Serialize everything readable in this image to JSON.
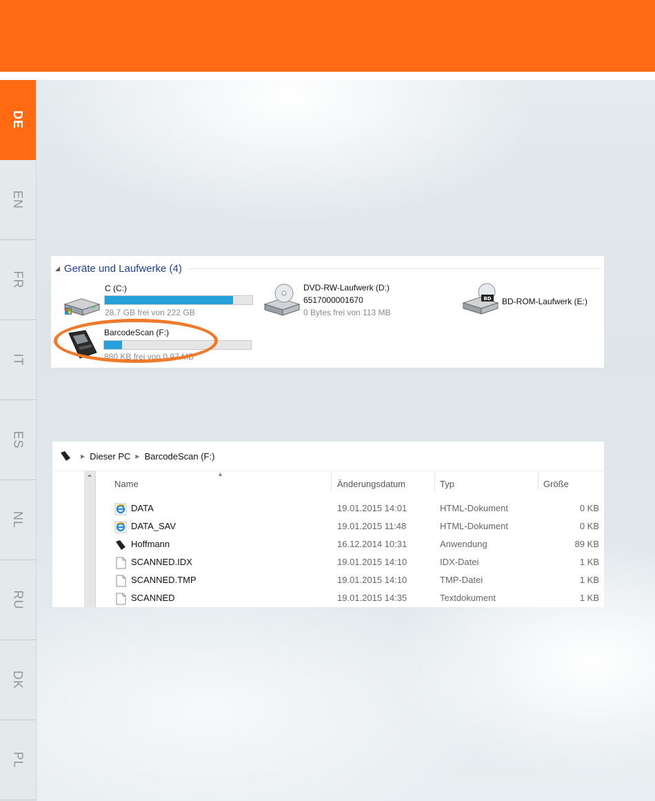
{
  "languages": [
    {
      "code": "DE",
      "active": true
    },
    {
      "code": "EN",
      "active": false
    },
    {
      "code": "FR",
      "active": false
    },
    {
      "code": "IT",
      "active": false
    },
    {
      "code": "ES",
      "active": false
    },
    {
      "code": "NL",
      "active": false
    },
    {
      "code": "RU",
      "active": false
    },
    {
      "code": "DK",
      "active": false
    },
    {
      "code": "PL",
      "active": false
    }
  ],
  "colors": {
    "accent": "#ff6a13",
    "highlight_ring": "#ef7a2a",
    "progress": "#26a0da",
    "group_title": "#1e3e97"
  },
  "devices": {
    "group_title": "Geräte und Laufwerke (4)",
    "drive_c": {
      "name": "C (C:)",
      "free": "28,7 GB frei von 222 GB",
      "used_fraction": 0.87
    },
    "drive_d": {
      "name": "DVD-RW-Laufwerk (D:)",
      "label": "6517000001670",
      "free": "0 Bytes frei von 113 MB"
    },
    "drive_e": {
      "name": "BD-ROM-Laufwerk (E:)"
    },
    "drive_f": {
      "name": "BarcodeScan (F:)",
      "free": "880 KB frei von 0,97 MB",
      "used_fraction": 0.12
    }
  },
  "explorer": {
    "breadcrumb": [
      "Dieser PC",
      "BarcodeScan (F:)"
    ],
    "columns": {
      "name": "Name",
      "date": "Änderungsdatum",
      "type": "Typ",
      "size": "Größe"
    },
    "files": [
      {
        "name": "DATA",
        "date": "19.01.2015 14:01",
        "type": "HTML-Dokument",
        "size": "0 KB",
        "icon": "ie-html-icon"
      },
      {
        "name": "DATA_SAV",
        "date": "19.01.2015 11:48",
        "type": "HTML-Dokument",
        "size": "0 KB",
        "icon": "ie-html-icon"
      },
      {
        "name": "Hoffmann",
        "date": "16.12.2014 10:31",
        "type": "Anwendung",
        "size": "89 KB",
        "icon": "scanner-app-icon"
      },
      {
        "name": "SCANNED.IDX",
        "date": "19.01.2015 14:10",
        "type": "IDX-Datei",
        "size": "1 KB",
        "icon": "file-icon"
      },
      {
        "name": "SCANNED.TMP",
        "date": "19.01.2015 14:10",
        "type": "TMP-Datei",
        "size": "1 KB",
        "icon": "file-icon"
      },
      {
        "name": "SCANNED",
        "date": "19.01.2015 14:35",
        "type": "Textdokument",
        "size": "1 KB",
        "icon": "file-icon"
      }
    ]
  }
}
